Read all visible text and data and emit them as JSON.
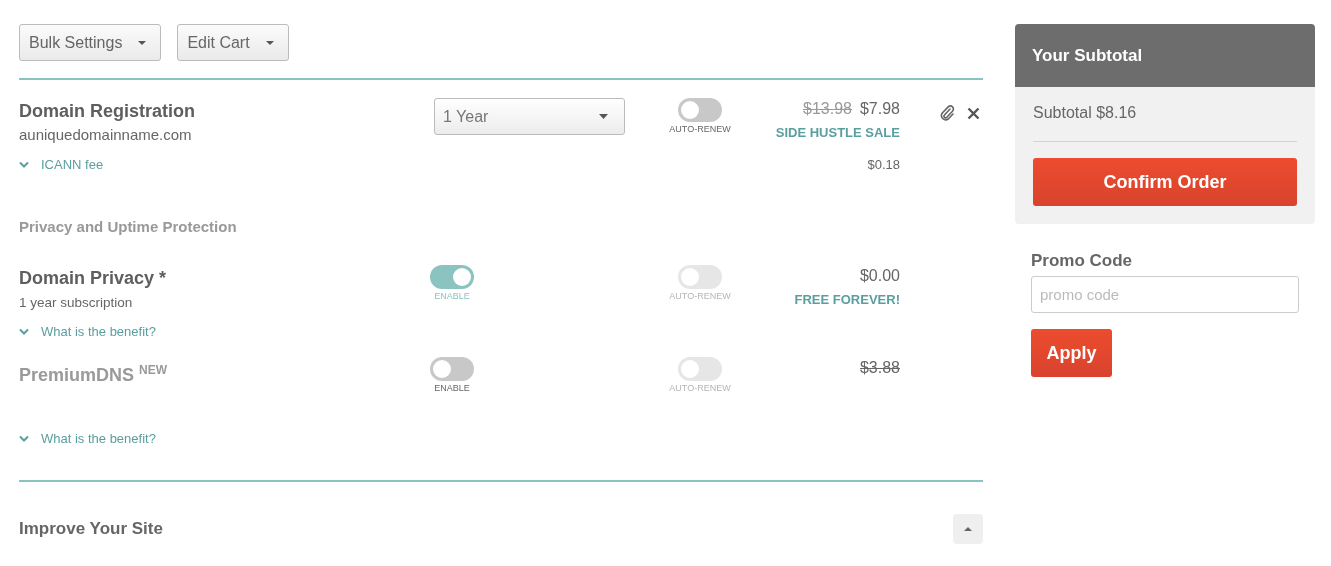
{
  "toolbar": [
    {
      "label": "Bulk Settings"
    },
    {
      "label": "Edit Cart"
    }
  ],
  "domain": {
    "title": "Domain Registration",
    "name": "auniquedomainname.com",
    "period": "1 Year",
    "auto_renew": {
      "label": "AUTO-RENEW",
      "on": false,
      "disabled": false
    },
    "old_price": "$13.98",
    "price": "$7.98",
    "promo": "SIDE HUSTLE SALE",
    "fee": {
      "label": "ICANN fee",
      "price": "$0.18",
      "expanded": false
    }
  },
  "section": "Privacy and Uptime Protection",
  "products": [
    {
      "title": "Domain Privacy *",
      "subtitle": "1 year subscription",
      "enable": {
        "label": "ENABLE",
        "on": true
      },
      "auto_renew": {
        "label": "AUTO-RENEW",
        "on": false,
        "disabled": true
      },
      "price": {
        "text": "$0.00",
        "struck": false
      },
      "promo": "FREE FOREVER!",
      "benefit": {
        "label": "What is the benefit?",
        "expanded": false
      }
    },
    {
      "title": "PremiumDNS $^{NEW}$",
      "enable": {
        "label": "ENABLE",
        "on": false
      },
      "auto_renew": {
        "label": "AUTO-RENEW",
        "on": false,
        "disabled": true
      },
      "price": {
        "text": "$3.88",
        "struck": true
      },
      "benefit": {
        "label": "What is the benefit?",
        "expanded": false
      }
    }
  ],
  "improve": {
    "title": "Improve Your Site",
    "expanded": true
  },
  "summary": {
    "title": "Your Subtotal",
    "subtotal": "Subtotal $8.16",
    "confirm": "Confirm Order"
  },
  "promo": {
    "label": "Promo Code",
    "placeholder": "promo code",
    "apply": "Apply"
  }
}
